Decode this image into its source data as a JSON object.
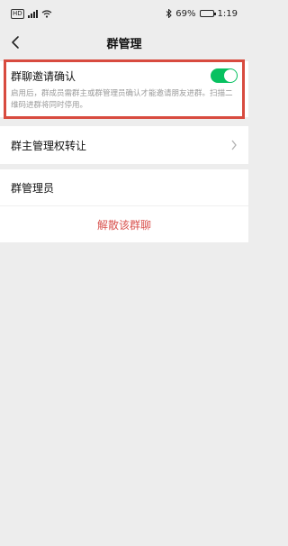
{
  "status_bar": {
    "hd_badge": "HD",
    "battery": "69%",
    "time": "1:19",
    "battery_level": 0.69
  },
  "nav": {
    "title": "群管理"
  },
  "invite_confirm": {
    "label": "群聊邀请确认",
    "description": "启用后，群成员需群主或群管理员确认才能邀请朋友进群。扫描二维码进群将同时停用。",
    "enabled": true
  },
  "owner_transfer": {
    "label": "群主管理权转让"
  },
  "admins": {
    "label": "群管理员"
  },
  "dismiss": {
    "label": "解散该群聊"
  },
  "colors": {
    "accent_green": "#07c160",
    "danger_red": "#d9534f",
    "highlight_red": "#d84b3f",
    "background": "#ededed"
  }
}
